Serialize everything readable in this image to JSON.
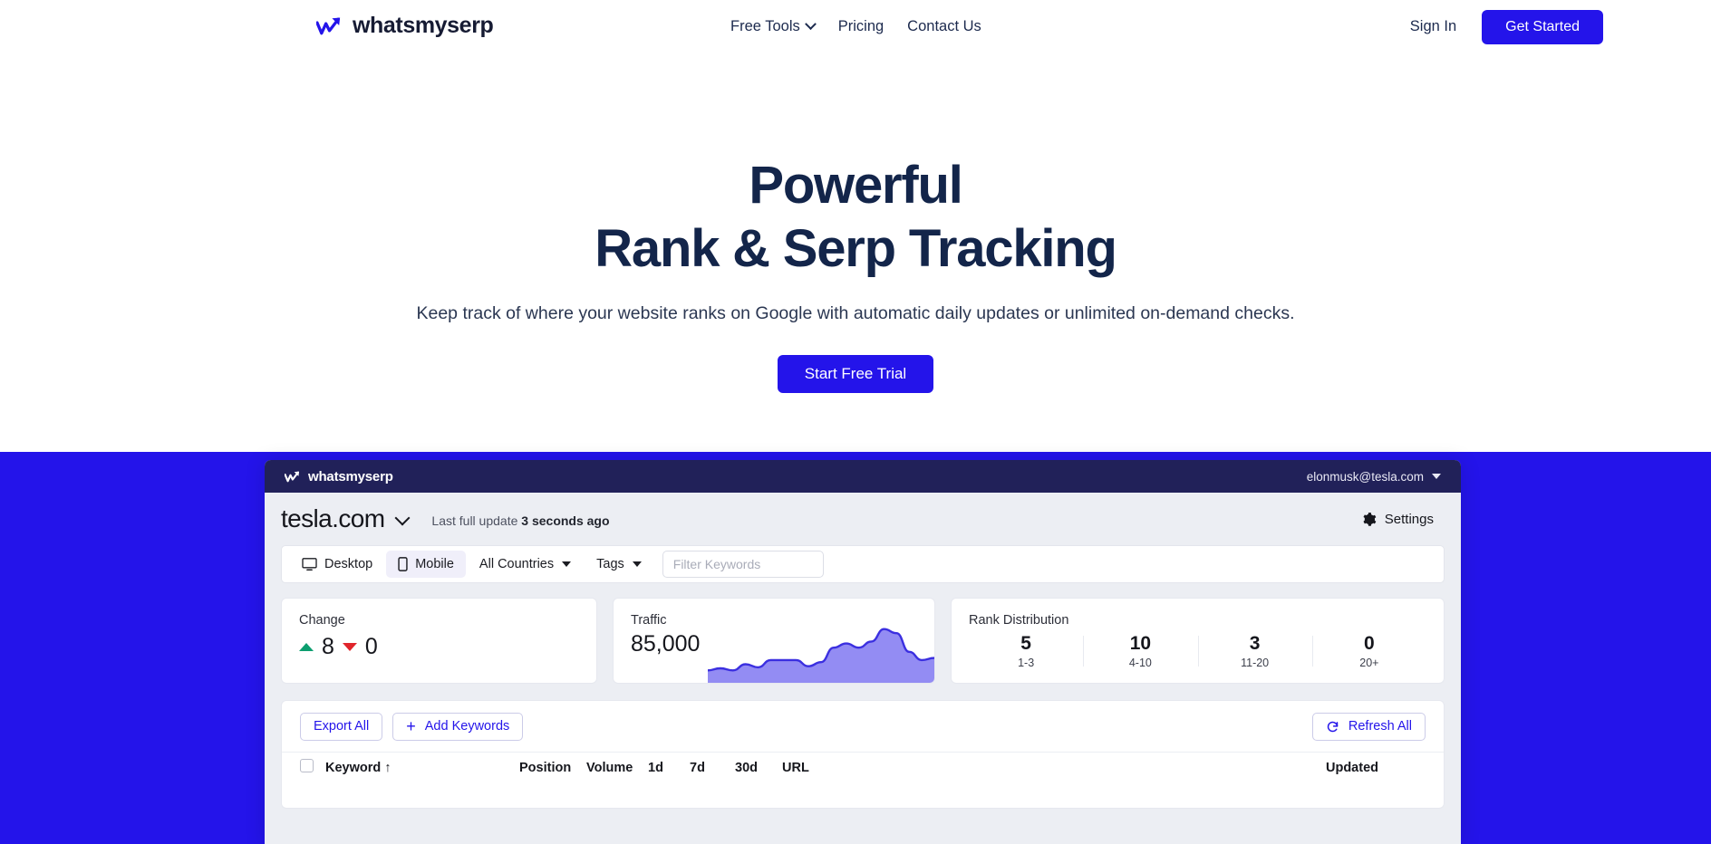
{
  "site": {
    "brand": "whatsmyserp",
    "nav": [
      {
        "label": "Free Tools",
        "has_dropdown": true
      },
      {
        "label": "Pricing",
        "has_dropdown": false
      },
      {
        "label": "Contact Us",
        "has_dropdown": false
      }
    ],
    "sign_in": "Sign In",
    "get_started": "Get Started"
  },
  "hero": {
    "title_line1": "Powerful",
    "title_line2": "Rank & Serp Tracking",
    "subtitle": "Keep track of where your website ranks on Google with automatic daily updates or unlimited on-demand checks.",
    "cta": "Start Free Trial"
  },
  "colors": {
    "brand_blue": "#2414ea",
    "navy": "#212159",
    "headline_navy": "#13254a",
    "up_green": "#0c9e6f",
    "down_red": "#e0252b",
    "spark_purple": "#7b73f0"
  },
  "app": {
    "bar": {
      "brand": "whatsmyserp",
      "user_email": "elonmusk@tesla.com"
    },
    "header": {
      "domain": "tesla.com",
      "last_update_prefix": "Last full update",
      "last_update_value": "3 seconds ago",
      "settings": "Settings"
    },
    "toolbar": {
      "device_desktop": "Desktop",
      "device_mobile": "Mobile",
      "device_selected": "Mobile",
      "countries": "All Countries",
      "tags": "Tags",
      "filter_placeholder": "Filter Keywords",
      "filter_value": ""
    },
    "cards": {
      "change": {
        "label": "Change",
        "up": "8",
        "down": "0"
      },
      "traffic": {
        "label": "Traffic",
        "value": "85,000"
      },
      "rank_distribution": {
        "label": "Rank Distribution",
        "buckets": [
          {
            "count": "5",
            "range": "1-3"
          },
          {
            "count": "10",
            "range": "4-10"
          },
          {
            "count": "3",
            "range": "11-20"
          },
          {
            "count": "0",
            "range": "20+"
          }
        ]
      }
    },
    "table": {
      "export_all": "Export All",
      "add_keywords": "Add Keywords",
      "refresh_all": "Refresh All",
      "columns": [
        "Keyword ↑",
        "Position",
        "Volume",
        "1d",
        "7d",
        "30d",
        "URL",
        "Updated"
      ]
    }
  },
  "chart_data": {
    "type": "area",
    "title": "Traffic",
    "series": [
      {
        "name": "Traffic",
        "values": [
          12,
          14,
          12,
          18,
          15,
          22,
          22,
          22,
          16,
          20,
          34,
          38,
          34,
          40,
          52,
          48,
          30,
          22,
          24
        ]
      }
    ],
    "x": [
      1,
      2,
      3,
      4,
      5,
      6,
      7,
      8,
      9,
      10,
      11,
      12,
      13,
      14,
      15,
      16,
      17,
      18,
      19
    ],
    "ylabel": "",
    "xlabel": "",
    "grid": false,
    "legend": "none"
  }
}
